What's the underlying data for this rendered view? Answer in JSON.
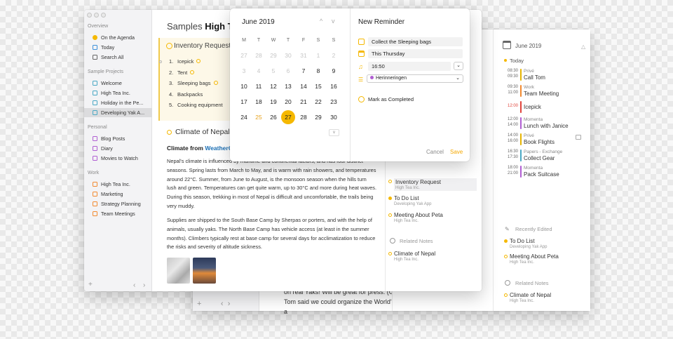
{
  "colors": {
    "accent": "#f5b800",
    "selected_bg": "#dcdcde",
    "link": "#1a6fb5"
  },
  "sidebar": {
    "sections": [
      {
        "title": "Overview",
        "items": [
          {
            "label": "On the Agenda",
            "icon": "sun-icon",
            "color": "#f5b800"
          },
          {
            "label": "Today",
            "icon": "calendar-icon",
            "color": "#3b8fd9"
          },
          {
            "label": "Search All",
            "icon": "search-icon",
            "color": "#666666"
          }
        ]
      },
      {
        "title": "Sample Projects",
        "items": [
          {
            "label": "Welcome",
            "icon": "project-icon",
            "color": "#4aa8c4"
          },
          {
            "label": "High Tea Inc.",
            "icon": "project-icon",
            "color": "#4aa8c4"
          },
          {
            "label": "Holiday in the Pe...",
            "icon": "project-icon",
            "color": "#4aa8c4"
          },
          {
            "label": "Developing Yak A...",
            "icon": "project-icon",
            "color": "#4aa8c4"
          }
        ]
      },
      {
        "title": "Personal",
        "items": [
          {
            "label": "Blog Posts",
            "icon": "project-icon",
            "color": "#b05ed2"
          },
          {
            "label": "Diary",
            "icon": "project-icon",
            "color": "#b05ed2"
          },
          {
            "label": "Movies to Watch",
            "icon": "project-icon",
            "color": "#b05ed2"
          }
        ]
      },
      {
        "title": "Work",
        "items": [
          {
            "label": "High Tea Inc.",
            "icon": "project-icon",
            "color": "#f28a30"
          },
          {
            "label": "Marketing",
            "icon": "project-icon",
            "color": "#f28a30"
          },
          {
            "label": "Strategy Planning",
            "icon": "project-icon",
            "color": "#f28a30"
          },
          {
            "label": "Team Meetings",
            "icon": "project-icon",
            "color": "#f28a30"
          }
        ]
      }
    ],
    "footer": {
      "add": "+",
      "back": "‹",
      "forward": "›"
    }
  },
  "doc": {
    "breadcrumb": "Samples",
    "title": "High Tea",
    "task_title": "Inventory Request",
    "tasks": [
      {
        "num": "1.",
        "text": "Icepick"
      },
      {
        "num": "2.",
        "text": "Tent"
      },
      {
        "num": "3.",
        "text": "Sleeping bags"
      },
      {
        "num": "4.",
        "text": "Backpacks"
      },
      {
        "num": "5.",
        "text": "Cooking equipment"
      }
    ],
    "section_title": "Climate of Nepal",
    "climate_prefix": "Climate from ",
    "climate_link": "WeatherO",
    "para1_partial": "Nepal is influenced by maritime and continental factors, and has four",
    "para1": "Nepal's climate is influenced by maritime and continental factors, and has four distinct seasons. Spring lasts from March to May, and is warm with rain showers, and temperatures around 22°C. Summer, from June to August, is the monsoon season when the hills turn lush and green. Temperatures can get quite warm, up to 30°C and more during heat waves. During this season, trekking in most of Nepal is difficult and uncomfortable, the trails being very muddy.",
    "para2": "Supplies are shipped to the South Base Camp by Sherpas or porters, and with the help of animals, usually yaks. The North Base Camp has vehicle access (at least in the summer months). Climbers typically rest at base camp for several days for acclimatization to reduce the risks and severity of altitude sickness."
  },
  "mid_col": {
    "items": [
      {
        "title": "Inventory Request",
        "sub": "High Tea Inc."
      },
      {
        "title": "To Do List",
        "sub": "Developing Yak App"
      },
      {
        "title": "Meeting About Peta",
        "sub": "High Tea Inc."
      }
    ],
    "related_header": "Related Notes",
    "related": [
      {
        "title": "Climate of Nepal",
        "sub": "High Tea Inc."
      }
    ]
  },
  "calendar": {
    "month": "June 2019",
    "prev": "^",
    "next": "v",
    "weekdays": [
      "M",
      "T",
      "W",
      "T",
      "F",
      "S",
      "S"
    ],
    "weeks": [
      [
        {
          "d": "27",
          "m": true
        },
        {
          "d": "28",
          "m": true
        },
        {
          "d": "29",
          "m": true
        },
        {
          "d": "30",
          "m": true
        },
        {
          "d": "31",
          "m": true
        },
        {
          "d": "1",
          "m": true
        },
        {
          "d": "2",
          "m": true
        }
      ],
      [
        {
          "d": "3",
          "m": true
        },
        {
          "d": "4",
          "m": true
        },
        {
          "d": "5",
          "m": true
        },
        {
          "d": "6",
          "m": true
        },
        {
          "d": "7"
        },
        {
          "d": "8"
        },
        {
          "d": "9"
        }
      ],
      [
        {
          "d": "10"
        },
        {
          "d": "11"
        },
        {
          "d": "12"
        },
        {
          "d": "13"
        },
        {
          "d": "14"
        },
        {
          "d": "15"
        },
        {
          "d": "16"
        }
      ],
      [
        {
          "d": "17"
        },
        {
          "d": "18"
        },
        {
          "d": "19"
        },
        {
          "d": "20"
        },
        {
          "d": "21"
        },
        {
          "d": "22"
        },
        {
          "d": "23"
        }
      ],
      [
        {
          "d": "24"
        },
        {
          "d": "25",
          "today": true
        },
        {
          "d": "26"
        },
        {
          "d": "27",
          "sel": true
        },
        {
          "d": "28"
        },
        {
          "d": "29"
        },
        {
          "d": "30"
        }
      ]
    ],
    "more": "v"
  },
  "reminder": {
    "title": "New Reminder",
    "task": "Collect the Sleeping bags",
    "date": "This Thursday",
    "time": "16:50",
    "calendar": "Herinneringen",
    "mark_completed": "Mark as Completed",
    "cancel": "Cancel",
    "save": "Save"
  },
  "agenda": {
    "month": "June 2019",
    "today_label": "Today",
    "events": [
      {
        "time": "08:30\n09:30",
        "cat": "Privé",
        "title": "Call Tom",
        "color": "#e6b400"
      },
      {
        "time": "09:30\n11:00",
        "cat": "Work",
        "title": "Team Meeting",
        "color": "#f28a30"
      },
      {
        "time": "12:00",
        "cat": "",
        "title": "Icepick",
        "color": "#e0433a"
      },
      {
        "time": "12:00\n14:00",
        "cat": "Momenta",
        "title": "Lunch with Janice",
        "color": "#b05ed2"
      },
      {
        "time": "14:00\n16:00",
        "cat": "Privé",
        "title": "Book Flights",
        "color": "#e6b400"
      },
      {
        "time": "16:30\n17:30",
        "cat": "Papers - Exchange",
        "title": "Collect Gear",
        "color": "#4aa8c4"
      },
      {
        "time": "18:00\n21:00",
        "cat": "Momenta",
        "title": "Pack Suitcase",
        "color": "#b05ed2"
      }
    ],
    "recent_header": "Recently Edited",
    "recent": [
      {
        "title": "To Do List",
        "sub": "Developing Yak App"
      },
      {
        "title": "Meeting About Peta",
        "sub": "High Tea Inc."
      }
    ],
    "related_header": "Related Notes",
    "related": [
      {
        "title": "Climate of Nepal",
        "sub": "High Tea Inc."
      }
    ]
  },
  "back_window": {
    "text1": "on real Yaks! Will be great for press. (Great idea. So clever.)",
    "text2": "Tom said we could organize the World's longest Conga line. (Sounds like a"
  }
}
